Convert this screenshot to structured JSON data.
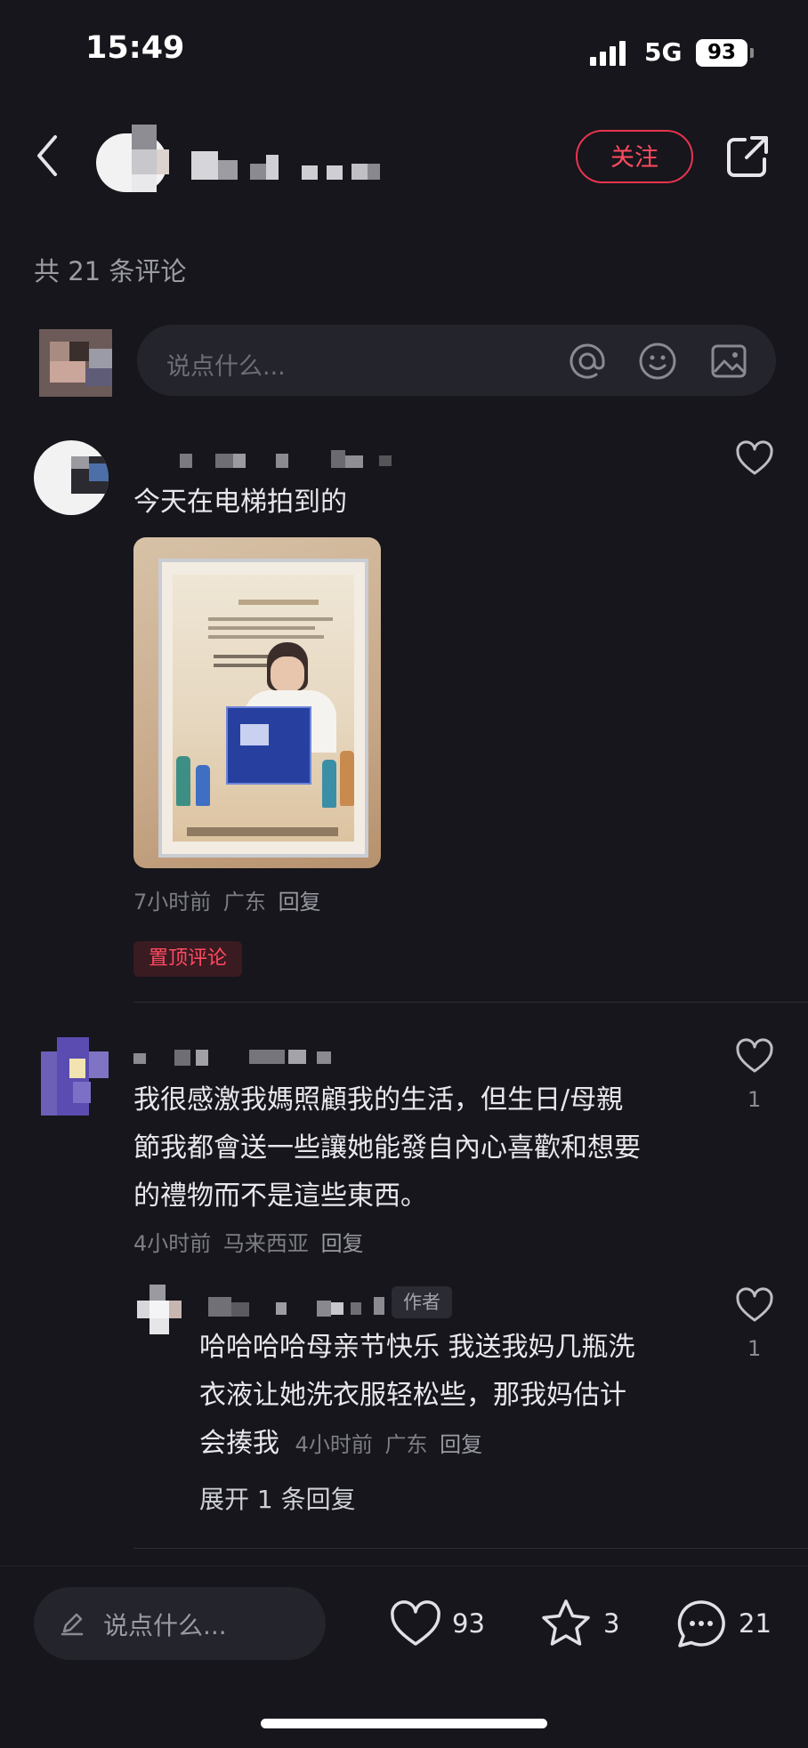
{
  "status_bar": {
    "time": "15:49",
    "network": "5G",
    "battery": "93"
  },
  "header": {
    "follow_label": "关注"
  },
  "comments_count_text": "共 21 条评论",
  "comment_input": {
    "placeholder": "说点什么..."
  },
  "comments": [
    {
      "text": "今天在电梯拍到的",
      "meta_time": "7小时前",
      "meta_location": "广东",
      "meta_reply": "回复",
      "pinned_label": "置顶评论",
      "likes": ""
    },
    {
      "text_lines": [
        "我很感激我媽照顧我的生活，但生日/母親",
        "節我都會送一些讓她能發自內心喜歡和想要",
        "的禮物而不是這些東西。"
      ],
      "meta_time": "4小时前",
      "meta_location": "马来西亚",
      "meta_reply": "回复",
      "likes": "1",
      "reply": {
        "author_badge": "作者",
        "text_lines": [
          "哈哈哈哈母亲节快乐 我送我妈几瓶洗",
          "衣液让她洗衣服轻松些，那我妈估计",
          "会揍我"
        ],
        "meta_time": "4小时前",
        "meta_location": "广东",
        "meta_reply": "回复",
        "likes": "1"
      },
      "expand_label": "展开 1 条回复"
    }
  ],
  "bottom_bar": {
    "placeholder": "说点什么...",
    "likes": "93",
    "favorites": "3",
    "comments": "21"
  }
}
